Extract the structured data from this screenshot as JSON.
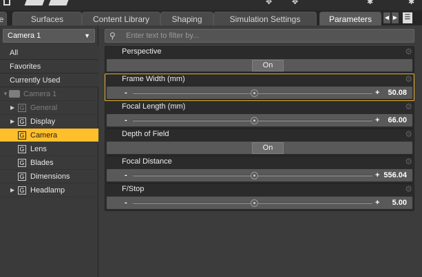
{
  "tabs": [
    "Surfaces",
    "Content Library",
    "Shaping",
    "Simulation Settings",
    "Parameters"
  ],
  "active_tab": "Parameters",
  "camera_selector": {
    "value": "Camera 1"
  },
  "groups": [
    "All",
    "Favorites",
    "Currently Used"
  ],
  "tree": {
    "node_label": "Camera 1",
    "items": [
      {
        "label": "General",
        "expandable": true,
        "state": "dimmed"
      },
      {
        "label": "Display",
        "expandable": true,
        "state": "normal"
      },
      {
        "label": "Camera",
        "expandable": false,
        "state": "selected"
      },
      {
        "label": "Lens",
        "expandable": false,
        "state": "normal"
      },
      {
        "label": "Blades",
        "expandable": false,
        "state": "normal"
      },
      {
        "label": "Dimensions",
        "expandable": false,
        "state": "normal"
      },
      {
        "label": "Headlamp",
        "expandable": true,
        "state": "normal"
      }
    ],
    "group_badge": "G"
  },
  "filter": {
    "placeholder": "Enter text to filter by..."
  },
  "properties": [
    {
      "name": "Perspective",
      "type": "toggle",
      "value": "On"
    },
    {
      "name": "Frame Width (mm)",
      "type": "slider",
      "value": "50.08",
      "highlighted": true
    },
    {
      "name": "Focal Length (mm)",
      "type": "slider",
      "value": "66.00"
    },
    {
      "name": "Depth of Field",
      "type": "toggle",
      "value": "On"
    },
    {
      "name": "Focal Distance",
      "type": "slider",
      "value": "556.04"
    },
    {
      "name": "F/Stop",
      "type": "slider",
      "value": "5.00"
    }
  ],
  "slider_symbols": {
    "minus": "-",
    "plus": "+"
  },
  "colors": {
    "selection": "#ffbf2b",
    "highlight_border": "#f0b52b",
    "panel": "#3c3c3c",
    "property_bg": "#2b2b2b"
  },
  "icons": {
    "search": "search-icon",
    "gear": "gear-icon",
    "camera": "camera-icon",
    "dropdown": "chevron-down-icon"
  }
}
